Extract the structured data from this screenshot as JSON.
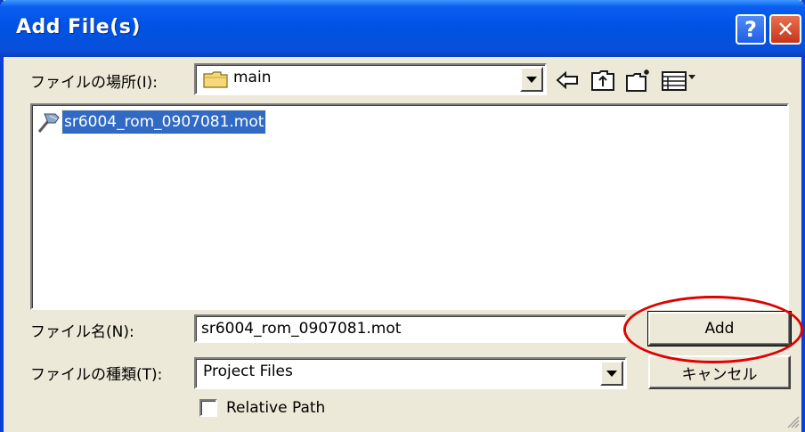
{
  "window": {
    "title": "Add File(s)",
    "help_glyph": "?",
    "close_glyph": "✕"
  },
  "look_in": {
    "label": "ファイルの場所(I):",
    "value": "main",
    "icon": "folder-icon"
  },
  "toolbar": {
    "icons": [
      "back-arrow-icon",
      "up-folder-icon",
      "new-folder-icon",
      "view-menu-icon"
    ]
  },
  "file_list": {
    "items": [
      {
        "name": "sr6004_rom_0907081.mot",
        "icon": "file-icon",
        "selected": true
      }
    ]
  },
  "file_name": {
    "label": "ファイル名(N):",
    "value": "sr6004_rom_0907081.mot"
  },
  "file_type": {
    "label": "ファイルの種類(T):",
    "value": "Project Files"
  },
  "buttons": {
    "add": "Add",
    "cancel": "キャンセル"
  },
  "relative_path": {
    "label": "Relative Path",
    "checked": false
  },
  "colors": {
    "titlebar": "#0053e6",
    "selection": "#316ac5",
    "highlight_ellipse": "#e00000",
    "dialog_bg": "#ece9d8"
  }
}
